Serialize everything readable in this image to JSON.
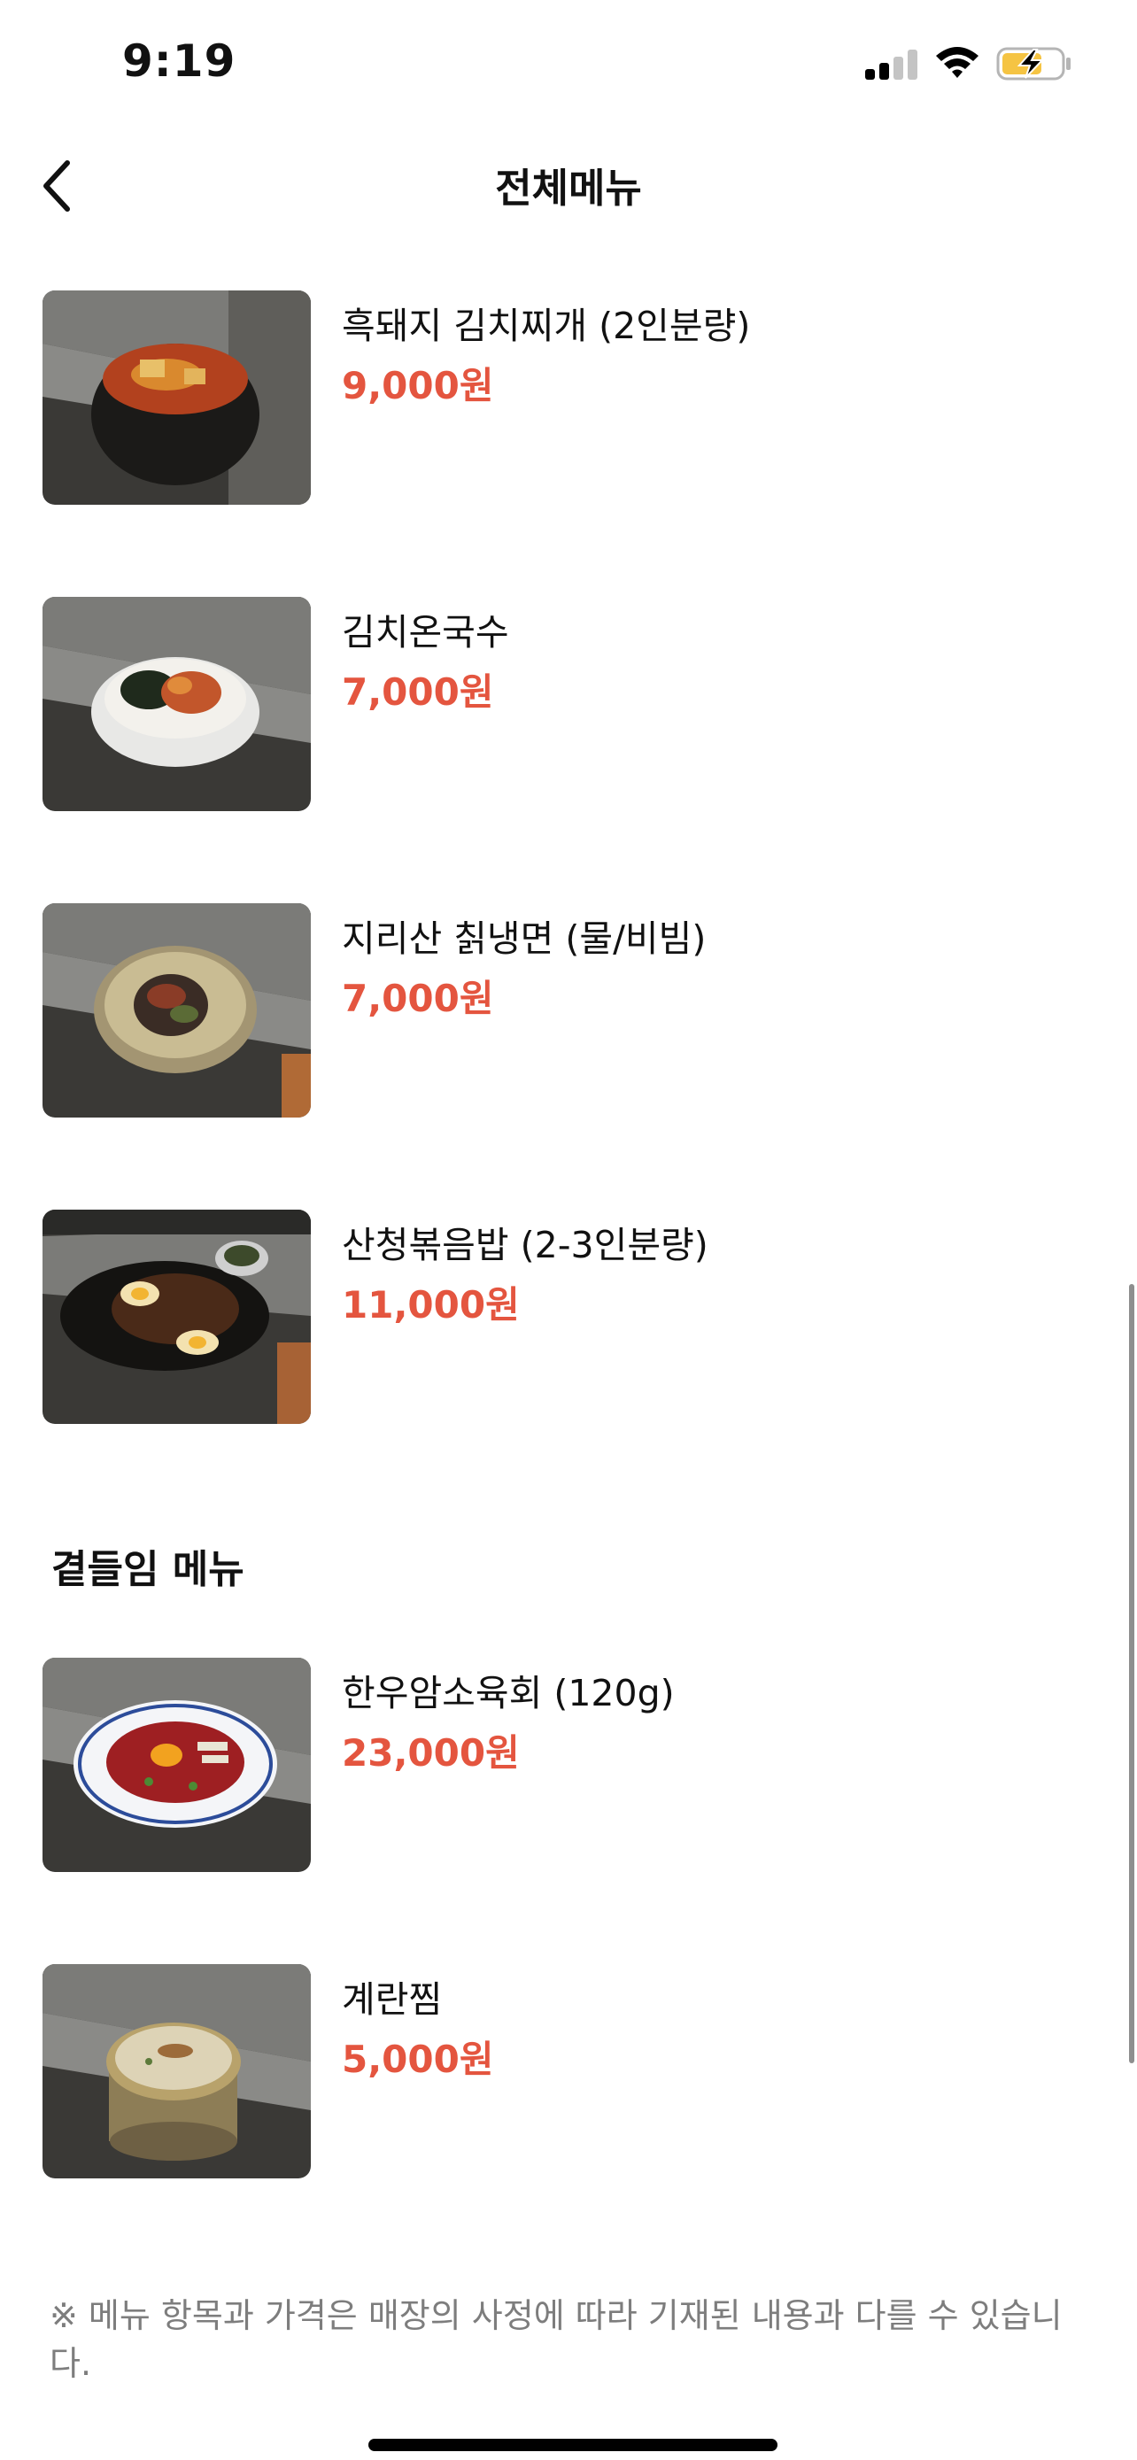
{
  "status_bar": {
    "time": "9:19"
  },
  "header": {
    "title": "전체메뉴"
  },
  "items": [
    {
      "name": "흑돼지 김치찌개 (2인분량)",
      "price": "9,000원"
    },
    {
      "name": "김치온국수",
      "price": "7,000원"
    },
    {
      "name": "지리산 칡냉면 (물/비빔)",
      "price": "7,000원"
    },
    {
      "name": "산청볶음밥 (2-3인분량)",
      "price": "11,000원"
    }
  ],
  "side_section": {
    "title": "곁들임 메뉴",
    "items": [
      {
        "name": "한우암소육회 (120g)",
        "price": "23,000원"
      },
      {
        "name": "계란찜",
        "price": "5,000원"
      }
    ]
  },
  "footnote": "※ 메뉴 항목과 가격은 매장의 사정에 따라 기재된 내용과 다를 수 있습니다.",
  "colors": {
    "price": "#e4553f",
    "battery_fill": "#f5c443"
  },
  "icons": [
    "back-chevron-icon",
    "cellular-signal-icon",
    "wifi-icon",
    "battery-charging-icon"
  ]
}
